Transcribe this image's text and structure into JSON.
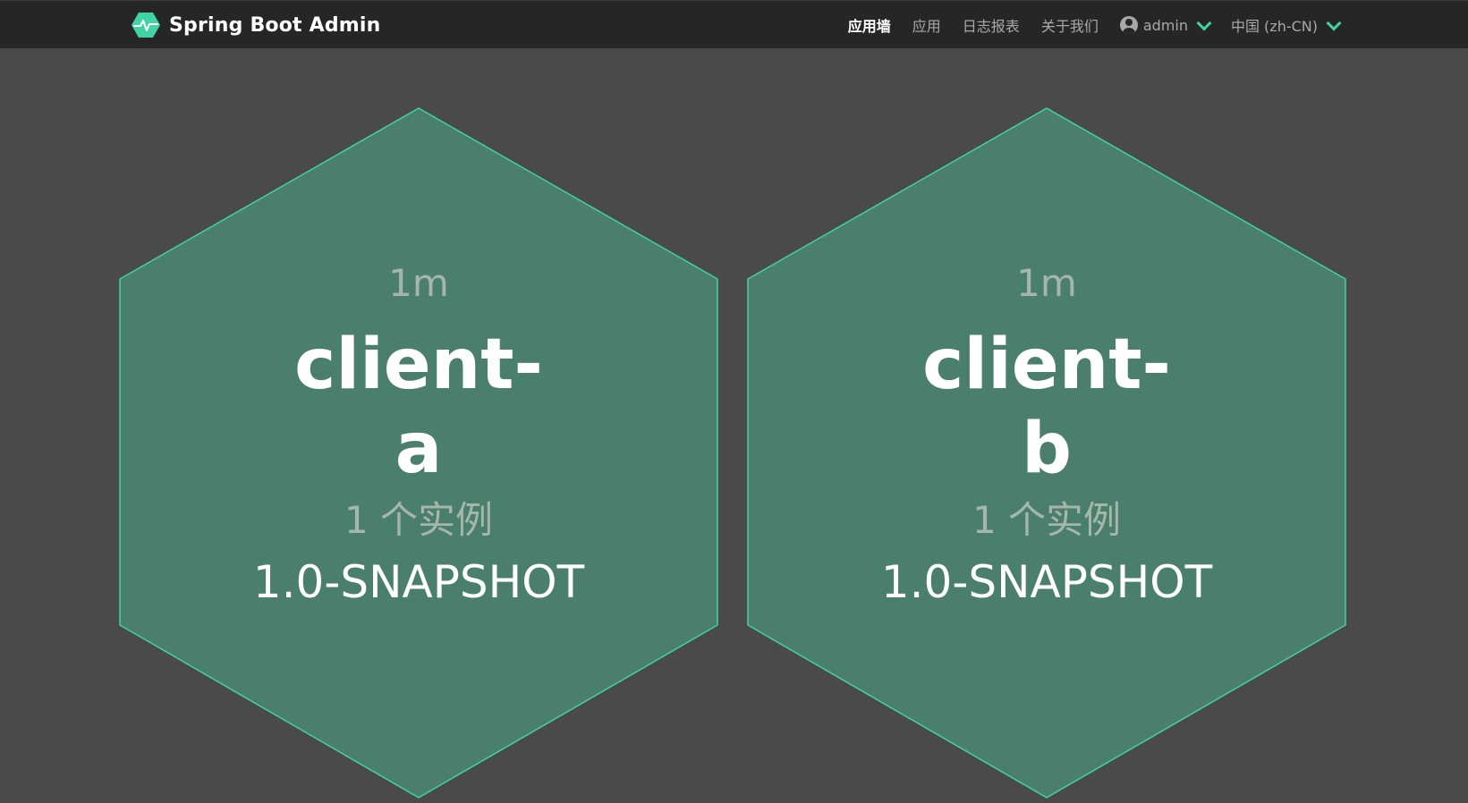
{
  "brand": {
    "title": "Spring Boot Admin",
    "icon": "heartbeat-hexagon-icon"
  },
  "nav": {
    "items": [
      {
        "label": "应用墙",
        "active": true
      },
      {
        "label": "应用",
        "active": false
      },
      {
        "label": "日志报表",
        "active": false
      },
      {
        "label": "关于我们",
        "active": false
      }
    ],
    "user": {
      "name": "admin",
      "icon": "user-circle-icon"
    },
    "language": {
      "label": "中国 (zh-CN)"
    }
  },
  "applications": [
    {
      "age": "1m",
      "name_line1": "client-",
      "name_line2": "a",
      "instances": "1 个实例",
      "version": "1.0-SNAPSHOT"
    },
    {
      "age": "1m",
      "name_line1": "client-",
      "name_line2": "b",
      "instances": "1 个实例",
      "version": "1.0-SNAPSHOT"
    }
  ],
  "colors": {
    "navbar": "#262626",
    "background": "#4a4a4a",
    "hex_fill": "#4a7e6d",
    "hex_stroke": "#42d3a5",
    "accent": "#42d3a5"
  }
}
